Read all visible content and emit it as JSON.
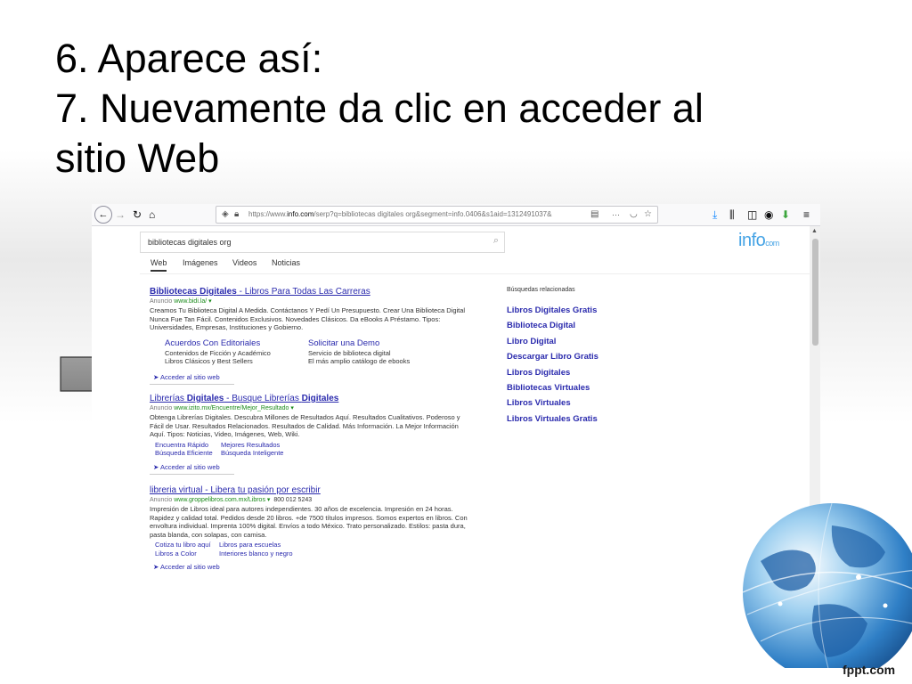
{
  "slide": {
    "title_lines": [
      "6. Aparece así:",
      "7. Nuevamente da clic en acceder al",
      "sitio Web"
    ],
    "watermark": "fppt.com"
  },
  "browser": {
    "url_prefix": "https://www.",
    "url_domain": "info.com",
    "url_rest": "/serp?q=bibliotecas digitales org&segment=info.0406&s1aid=1312491037&",
    "url_ellipsis": "···"
  },
  "page": {
    "logo": "info",
    "logo_suffix": "com",
    "search_value": "bibliotecas digitales org",
    "tabs": [
      "Web",
      "Imágenes",
      "Videos",
      "Noticias"
    ],
    "results": [
      {
        "title_a": "Bibliotecas Digitales",
        "title_b": " - Libros Para Todas Las Carreras",
        "ad_label": "Anuncio",
        "url": "www.bidi.la/",
        "desc": "Creamos Tu Biblioteca Digital A Medida. Contáctanos Y Pedí Un Presupuesto. Crear Una Biblioteca Digital Nunca Fue Tan Fácil. Contenidos Exclusivos. Novedades Clásicos. Da eBooks A Préstamo. Tipos: Universidades, Empresas, Instituciones y Gobierno.",
        "sitelinks": [
          {
            "title": "Acuerdos Con Editoriales",
            "desc1": "Contenidos de Ficción y Académico",
            "desc2": "Libros Clásicos y Best Sellers"
          },
          {
            "title": "Solicitar una Demo",
            "desc1": "Servicio de biblioteca digital",
            "desc2": "El más amplio catálogo de ebooks"
          }
        ],
        "visit": "Acceder al sitio web"
      },
      {
        "title_a": "Librerías ",
        "title_b": "Digitales",
        "title_c": " - Busque Librerías ",
        "title_d": "Digitales",
        "ad_label": "Anuncio",
        "url": "www.izito.mx/Encuentre/Mejor_Resultado",
        "desc": "Obtenga Librerías Digitales. Descubra Millones de Resultados Aquí. Resultados Cualitativos. Poderoso y Fácil de Usar. Resultados Relacionados. Resultados de Calidad. Más Información. La Mejor Información Aquí. Tipos: Noticias, Video, Imágenes, Web, Wiki.",
        "links": [
          "Encuentra Rápido",
          "Mejores Resultados",
          "Búsqueda Eficiente",
          "Búsqueda Inteligente"
        ],
        "visit": "Acceder al sitio web"
      },
      {
        "title": "libreria virtual - Libera tu pasión por escribir",
        "ad_label": "Anuncio",
        "url": "www.groppelibros.com.mx/Libros",
        "phone": "800 012 5243",
        "desc": "Impresión de Libros ideal para autores independientes. 30 años de excelencia. Impresión en 24 horas. Rapidez y calidad total. Pedidos desde 20 libros. +de 7500 títulos impresos. Somos expertos en libros. Con envoltura individual. Imprenta 100% digital. Envíos a todo México. Trato personalizado. Estilos: pasta dura, pasta blanda, con solapas, con camisa.",
        "links": [
          "Cotiza tu libro aquí",
          "Libros para escuelas",
          "Libros a Color",
          "Interiores blanco y negro"
        ],
        "visit": "Acceder al sitio web"
      }
    ],
    "related_title": "Búsquedas relacionadas",
    "related": [
      "Libros Digitales Gratis",
      "Biblioteca Digital",
      "Libro Digital",
      "Descargar Libro Gratis",
      "Libros Digitales",
      "Bibliotecas Virtuales",
      "Libros Virtuales",
      "Libros Virtuales Gratis"
    ]
  }
}
